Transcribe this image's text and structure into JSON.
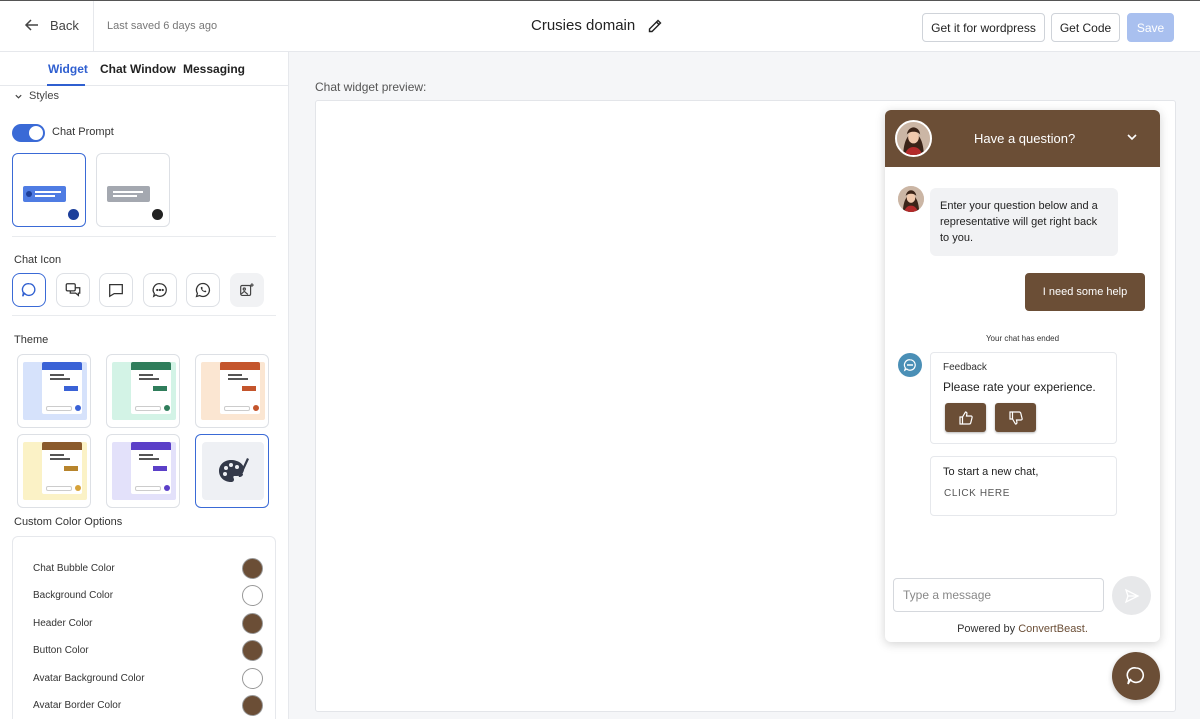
{
  "header": {
    "back_label": "Back",
    "last_saved": "Last saved 6 days ago",
    "title": "Crusies domain",
    "buttons": {
      "wordpress": "Get it for wordpress",
      "code": "Get Code",
      "save": "Save"
    }
  },
  "sidebar": {
    "tabs": [
      "Widget",
      "Chat Window",
      "Messaging"
    ],
    "active_tab": "Widget",
    "styles_label": "Styles",
    "chat_prompt_label": "Chat Prompt",
    "chat_prompt_enabled": true,
    "chat_icon_label": "Chat Icon",
    "chat_icons": [
      "chat-bubble-icon",
      "double-chat-icon",
      "square-chat-icon",
      "dots-chat-icon",
      "whatsapp-icon",
      "custom-image-icon"
    ],
    "theme_label": "Theme",
    "themes": [
      {
        "name": "blue",
        "bg": "#d6e2fb",
        "accent": "#3a62d6",
        "selected": false
      },
      {
        "name": "green",
        "bg": "#d3f3e6",
        "accent": "#2f7d5b",
        "selected": false
      },
      {
        "name": "orange",
        "bg": "#fbe6d2",
        "accent": "#c4552c",
        "selected": false
      },
      {
        "name": "yellow",
        "bg": "#fbf2c6",
        "accent": "#b7842c",
        "selected": false
      },
      {
        "name": "purple",
        "bg": "#e3e1fa",
        "accent": "#5b3fc8",
        "selected": false
      },
      {
        "name": "custom-palette",
        "selected": true
      }
    ],
    "custom_color_label": "Custom Color Options",
    "colors": [
      {
        "label": "Chat Bubble Color",
        "value": "#6b4e36"
      },
      {
        "label": "Background Color",
        "value": "#ffffff"
      },
      {
        "label": "Header Color",
        "value": "#6b4e36"
      },
      {
        "label": "Button Color",
        "value": "#6b4e36"
      },
      {
        "label": "Avatar Background Color",
        "value": "#ffffff"
      },
      {
        "label": "Avatar Border Color",
        "value": "#6b4e36"
      }
    ]
  },
  "preview": {
    "label": "Chat widget preview:",
    "widget": {
      "header_title": "Have a question?",
      "welcome_message": "Enter your question below and a representative will get right back to you.",
      "user_message": "I need some help",
      "ended_notice": "Your chat has ended",
      "feedback_title": "Feedback",
      "feedback_prompt": "Please rate your experience.",
      "new_chat_text": "To start a new chat,",
      "new_chat_link": "CLICK HERE",
      "input_placeholder": "Type a message",
      "powered_by": "Powered by",
      "brand": "ConvertBeast."
    }
  },
  "colors": {
    "accent": "#2f5fd0",
    "brand_brown": "#6b4e36",
    "save_disabled": "#a9c0ef"
  }
}
